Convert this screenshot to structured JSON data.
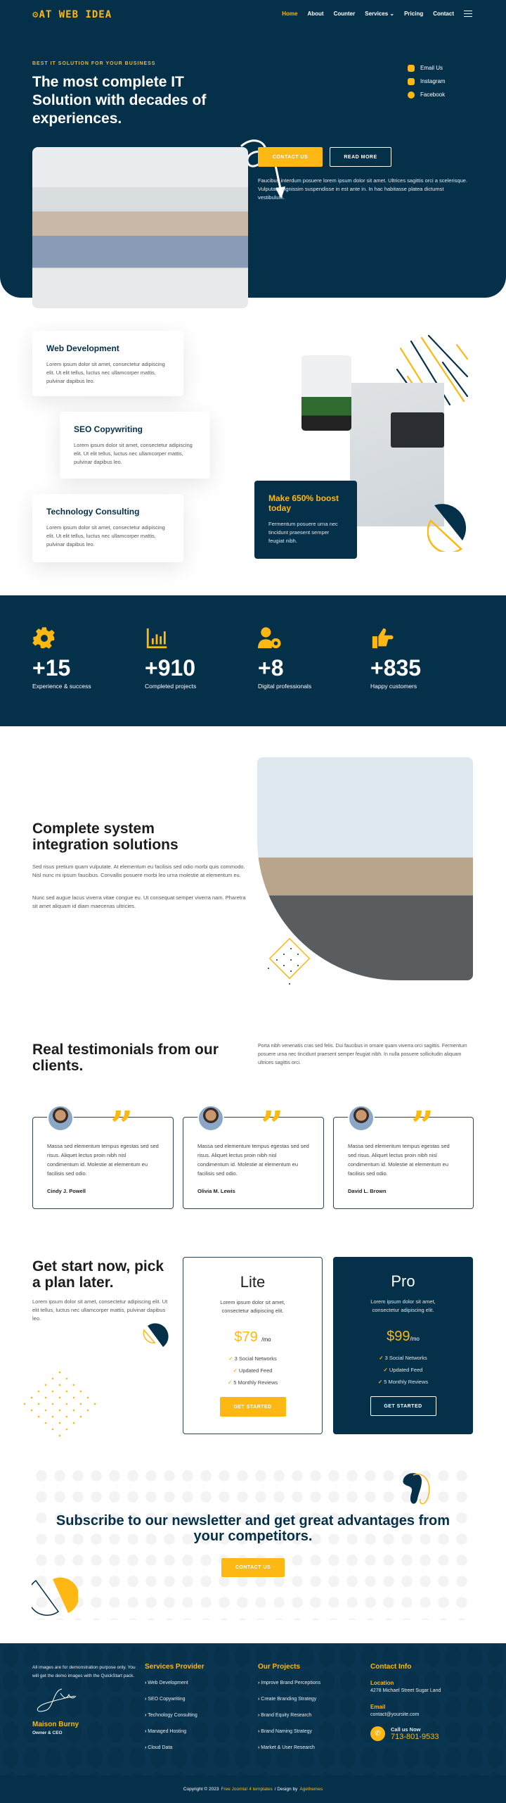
{
  "brand": {
    "logo": "AT WEB IDEA",
    "accent": "#fdb813",
    "navy": "#05304a"
  },
  "nav": {
    "items": [
      "Home",
      "About",
      "Counter",
      "Services",
      "Pricing",
      "Contact"
    ],
    "active": "Home"
  },
  "hero": {
    "tagline": "BEST IT SOLUTION FOR YOUR BUSINESS",
    "title": "The most complete IT Solution with decades of experiences.",
    "contact_btn": "CONTACT US",
    "read_more_btn": "READ MORE",
    "paragraph": "Faucibus interdum posuere lorem ipsum dolor sit amet. Ultrices sagittis orci a scelerisque. Vulputate dignissim suspendisse in est ante in. In hac habitasse platea dictumst vestibulum.",
    "social": [
      {
        "label": "Email Us",
        "icon": "envelope-icon"
      },
      {
        "label": "Instagram",
        "icon": "instagram-icon"
      },
      {
        "label": "Facebook",
        "icon": "messenger-icon"
      }
    ]
  },
  "services": [
    {
      "title": "Web Development",
      "text": "Lorem ipsum dolor sit amet, consectetur adipiscing elit. Ut elit tellus, luctus nec ullamcorper mattis, pulvinar dapibus leo."
    },
    {
      "title": "SEO Copywriting",
      "text": "Lorem ipsum dolor sit amet, consectetur adipiscing elit. Ut elit tellus, luctus nec ullamcorper mattis, pulvinar dapibus leo."
    },
    {
      "title": "Technology Consulting",
      "text": "Lorem ipsum dolor sit amet, consectetur adipiscing elit. Ut elit tellus, luctus nec ullamcorper mattis, pulvinar dapibus leo."
    }
  ],
  "boost": {
    "title": "Make 650% boost today",
    "text": "Fermentum posuere urna nec tincidunt praesent semper feugiat nibh."
  },
  "stats": [
    {
      "icon": "gear-icon",
      "value": "+15",
      "label": "Experience & success"
    },
    {
      "icon": "bar-chart-icon",
      "value": "+910",
      "label": "Completed projects"
    },
    {
      "icon": "user-gear-icon",
      "value": "+8",
      "label": "Digital professionals"
    },
    {
      "icon": "thumbs-up-icon",
      "value": "+835",
      "label": "Happy customers"
    }
  ],
  "integration": {
    "title": "Complete system integration solutions",
    "p1": "Sed risus pretium quam vulputate. At elementum eu facilisis sed odio morbi quis commodo. Nisl nunc mi ipsum faucibus. Convallis posuere morbi leo urna molestie at elementum eu.",
    "p2": "Nunc sed augue lacus viverra vitae congue eu. Ut consequat semper viverra nam. Pharetra sit amet aliquam id diam maecenas ultricies."
  },
  "testimonials": {
    "title": "Real testimonials from our clients.",
    "intro": "Porta nibh venenatis cras sed felis. Dui faucibus in ornare quam viverra orci sagittis. Fermentum posuere urna nec tincidunt praesent semper feugiat nibh. In nulla posuere sollicitudin aliquam ultrices sagittis orci.",
    "items": [
      {
        "text": "Massa sed elementum tempus egestas sed sed risus. Aliquet lectus proin nibh nisl condimentum id. Molestie at elementum eu facilisis sed odio.",
        "name": "Cindy J. Powell"
      },
      {
        "text": "Massa sed elementum tempus egestas sed sed risus. Aliquet lectus proin nibh nisl condimentum id. Molestie at elementum eu facilisis sed odio.",
        "name": "Olivia M. Lewis"
      },
      {
        "text": "Massa sed elementum tempus egestas sed sed risus. Aliquet lectus proin nibh nisl condimentum id. Molestie at elementum eu facilisis sed odio.",
        "name": "David L. Brown"
      }
    ]
  },
  "pricing": {
    "title": "Get start now, pick a plan later.",
    "text": "Lorem ipsum dolor sit amet, consectetur adipiscing elit. Ut elit tellus, luctus nec ullamcorper mattis, pulvinar dapibus leo.",
    "plans": [
      {
        "name": "Lite",
        "desc": "Lorem ipsum dolor sit amet, consectetur adipiscing elit.",
        "price": "$79",
        "per": "/mo",
        "features": [
          "3 Social Networks",
          "Updated Feed",
          "5 Monthly Reviews"
        ],
        "cta": "GET STARTED"
      },
      {
        "name": "Pro",
        "desc": "Lorem ipsum dolor sit amet, consectetur adipiscing elit.",
        "price": "$99",
        "per": "/mo",
        "features": [
          "3 Social Networks",
          "Updated Feed",
          "5 Monthly Reviews"
        ],
        "cta": "GET STARTED"
      }
    ]
  },
  "subscribe": {
    "title": "Subscribe to our newsletter and get great advantages from your competitors.",
    "cta": "CONTACT US"
  },
  "footer": {
    "about": "All images are for demonstration purpose only. You will get the demo images with the QuickStart pack.",
    "owner_name": "Maison Burny",
    "owner_role": "Owner & CEO",
    "services_title": "Services Provider",
    "services": [
      "Web Development",
      "SEO Copywriting",
      "Technology Consulting",
      "Managed Hosting",
      "Cloud Data"
    ],
    "projects_title": "Our Projects",
    "projects": [
      "Improve Brand Perceptions",
      "Create Branding Strategy",
      "Brand Equity Research",
      "Brand Naming Strategy",
      "Market & User Research"
    ],
    "contact_title": "Contact Info",
    "location_label": "Location",
    "location": "4278 Michael Street Sugar Land",
    "email_label": "Email",
    "email": "contact@yoursite.com",
    "call_label": "Call us Now",
    "phone": "713-801-9533",
    "copyright_pre": "Copyright © 2023",
    "copyright_link": "Free Joomla! 4 templates",
    "copyright_mid": "/ Design by",
    "designer": "Agethemes"
  }
}
